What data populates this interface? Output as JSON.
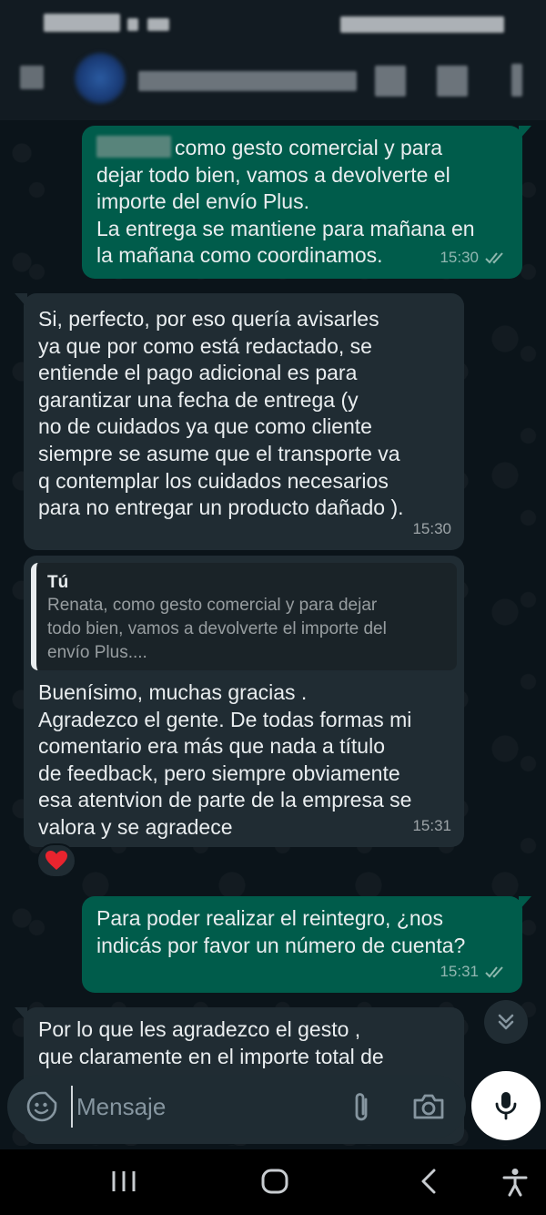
{
  "chat": {
    "messages": [
      {
        "direction": "out",
        "text": "como gesto comercial y para\ndejar todo bien, vamos a devolverte el\nimporte del envío Plus.\nLa entrega se mantiene para mañana en\nla mañana como coordinamos.",
        "time": "15:30",
        "status": "read"
      },
      {
        "direction": "in",
        "text": "Si, perfecto, por eso quería avisarles\nya que por como está redactado, se\nentiende el pago adicional es para\ngarantizar una fecha de entrega (y\nno de cuidados ya que como cliente\nsiempre se asume que el transporte va\nq contemplar los cuidados necesarios\npara no entregar un producto dañado ).",
        "time": "15:30"
      },
      {
        "direction": "in",
        "quote": {
          "author": "Tú",
          "text": "Renata, como gesto comercial y para dejar\ntodo bien, vamos a devolverte el importe del\nenvío Plus...."
        },
        "text": "Buenísimo, muchas gracias .\nAgradezco el gente. De todas formas mi\ncomentario era más que nada a título\nde feedback, pero siempre obviamente\nesa atentvion de parte de la empresa se\nvalora y se agradece",
        "time": "15:31",
        "reaction": "❤️"
      },
      {
        "direction": "out",
        "text": "Para poder realizar el reintegro, ¿nos\nindicás por favor un número de cuenta?",
        "time": "15:31",
        "status": "read"
      },
      {
        "direction": "in",
        "text": "Por lo que les agradezco el gesto ,\nque claramente en el importe total de",
        "time": ""
      }
    ]
  },
  "input": {
    "placeholder": "Mensaje"
  },
  "icons": {
    "emoji": "sticker-icon",
    "attach": "paperclip-icon",
    "camera": "camera-icon",
    "mic": "mic-icon",
    "scroll": "chevron-double-down-icon"
  },
  "colors": {
    "background": "#0b141a",
    "outgoing_bubble": "#005c4b",
    "incoming_bubble": "#202c33",
    "read_ticks": "#8eb8ae"
  }
}
